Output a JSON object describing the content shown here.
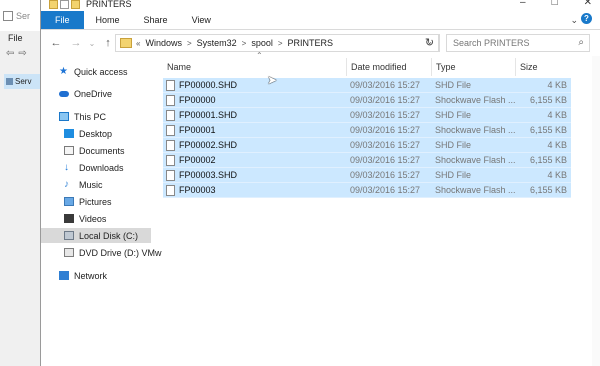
{
  "bg_window": {
    "title": "Ser",
    "menu_file": "File",
    "tree_item": "Serv"
  },
  "window": {
    "title": "PRINTERS",
    "controls": {
      "minimize": "–",
      "maximize": "□",
      "close": "✕"
    }
  },
  "ribbon": {
    "tabs": [
      "File",
      "Home",
      "Share",
      "View"
    ],
    "expand": "⌄",
    "help": "?"
  },
  "address": {
    "prefix": "«",
    "crumbs": [
      "Windows",
      "System32",
      "spool",
      "PRINTERS"
    ],
    "separator": ">"
  },
  "search": {
    "placeholder": "Search PRINTERS"
  },
  "nav": {
    "items": [
      {
        "label": "Quick access",
        "icon": "star-icon"
      },
      {
        "label": "OneDrive",
        "icon": "cloud-icon"
      },
      {
        "label": "This PC",
        "icon": "computer-icon"
      },
      {
        "label": "Desktop",
        "icon": "desktop-icon"
      },
      {
        "label": "Documents",
        "icon": "documents-icon"
      },
      {
        "label": "Downloads",
        "icon": "downloads-icon"
      },
      {
        "label": "Music",
        "icon": "music-icon"
      },
      {
        "label": "Pictures",
        "icon": "pictures-icon"
      },
      {
        "label": "Videos",
        "icon": "videos-icon"
      },
      {
        "label": "Local Disk (C:)",
        "icon": "disk-icon"
      },
      {
        "label": "DVD Drive (D:) VMw",
        "icon": "dvd-icon"
      },
      {
        "label": "Network",
        "icon": "network-icon"
      }
    ]
  },
  "columns": {
    "name": "Name",
    "date": "Date modified",
    "type": "Type",
    "size": "Size"
  },
  "files": [
    {
      "name": "FP00000.SHD",
      "date": "09/03/2016 15:27",
      "type": "SHD File",
      "size": "4 KB"
    },
    {
      "name": "FP00000",
      "date": "09/03/2016 15:27",
      "type": "Shockwave Flash ...",
      "size": "6,155 KB"
    },
    {
      "name": "FP00001.SHD",
      "date": "09/03/2016 15:27",
      "type": "SHD File",
      "size": "4 KB"
    },
    {
      "name": "FP00001",
      "date": "09/03/2016 15:27",
      "type": "Shockwave Flash ...",
      "size": "6,155 KB"
    },
    {
      "name": "FP00002.SHD",
      "date": "09/03/2016 15:27",
      "type": "SHD File",
      "size": "4 KB"
    },
    {
      "name": "FP00002",
      "date": "09/03/2016 15:27",
      "type": "Shockwave Flash ...",
      "size": "6,155 KB"
    },
    {
      "name": "FP00003.SHD",
      "date": "09/03/2016 15:27",
      "type": "SHD File",
      "size": "4 KB"
    },
    {
      "name": "FP00003",
      "date": "09/03/2016 15:27",
      "type": "Shockwave Flash ...",
      "size": "6,155 KB"
    }
  ],
  "colors": {
    "accent": "#1979ca",
    "selection": "#cce8ff",
    "nav_selected": "#d9d9d9"
  }
}
